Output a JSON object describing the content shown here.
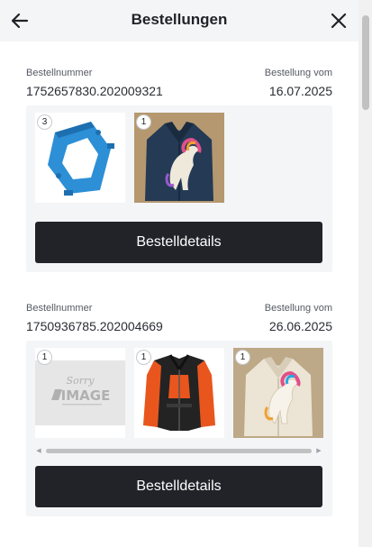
{
  "header": {
    "title": "Bestellungen",
    "back_icon": "arrow-left-icon",
    "close_icon": "close-icon"
  },
  "orders": [
    {
      "number_label": "Bestellnummer",
      "number": "1752657830.202009321",
      "date_label": "Bestellung vom",
      "date": "16.07.2025",
      "items": [
        {
          "qty": "3",
          "image": "blue-plastic-frame-part"
        },
        {
          "qty": "1",
          "image": "dark-denim-jacket-with-unicorn"
        }
      ],
      "button_label": "Bestelldetails"
    },
    {
      "number_label": "Bestellnummer",
      "number": "1750936785.202004669",
      "date_label": "Bestellung vom",
      "date": "26.06.2025",
      "items": [
        {
          "qty": "1",
          "image": "placeholder-no-image"
        },
        {
          "qty": "1",
          "image": "black-orange-motorcycle-jacket"
        },
        {
          "qty": "1",
          "image": "white-jacket-with-unicorn"
        }
      ],
      "placeholder_text": {
        "line1": "Sorry",
        "line2": "IMAGE"
      },
      "button_label": "Bestelldetails"
    }
  ],
  "colors": {
    "header_bg": "#f4f5f7",
    "panel_bg": "#f4f5f7",
    "button_bg": "#212329",
    "button_text": "#ffffff"
  }
}
